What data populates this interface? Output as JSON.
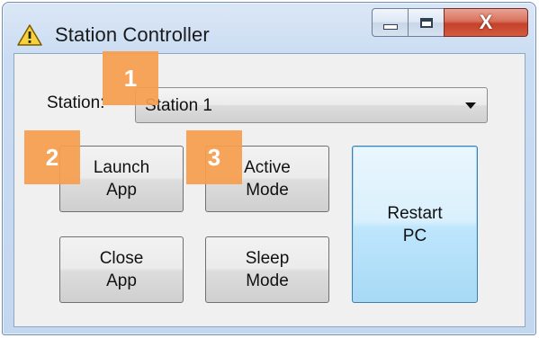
{
  "window": {
    "title": "Station Controller",
    "icon": "warning-icon",
    "caption": {
      "close_label": "X"
    }
  },
  "station": {
    "label": "Station:",
    "selected": "Station 1"
  },
  "buttons": {
    "launch_app": {
      "line1": "Launch",
      "line2": "App"
    },
    "active_mode": {
      "line1": "Active",
      "line2": "Mode"
    },
    "close_app": {
      "line1": "Close",
      "line2": "App"
    },
    "sleep_mode": {
      "line1": "Sleep",
      "line2": "Mode"
    },
    "restart_pc": {
      "line1": "Restart",
      "line2": "PC"
    }
  },
  "badges": [
    "1",
    "2",
    "3"
  ],
  "colors": {
    "badge": "#f79d4e",
    "close_button": "#c5412a",
    "focus_border": "#3c7fb1",
    "title_bar": "#c9dcf2"
  }
}
